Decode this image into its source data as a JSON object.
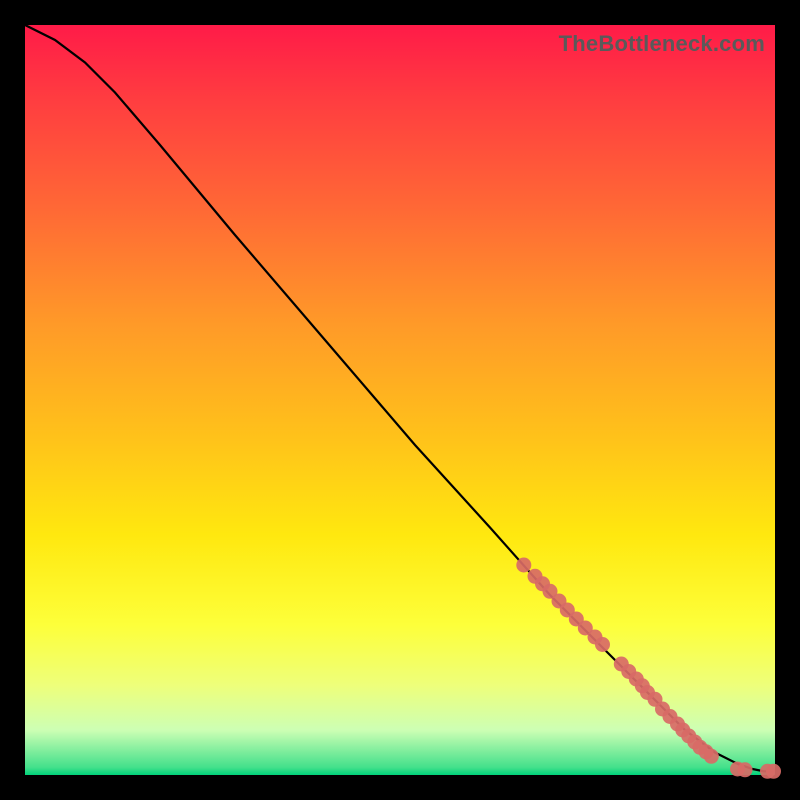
{
  "watermark": "TheBottleneck.com",
  "chart_data": {
    "type": "line",
    "title": "",
    "xlabel": "",
    "ylabel": "",
    "xlim": [
      0,
      100
    ],
    "ylim": [
      0,
      100
    ],
    "curve": {
      "x": [
        0,
        4,
        8,
        12,
        18,
        28,
        40,
        52,
        62,
        70,
        78,
        84,
        88,
        92,
        95,
        97,
        98.5,
        100
      ],
      "y": [
        100,
        98,
        95,
        91,
        84,
        72,
        58,
        44,
        33,
        24,
        16,
        10,
        6,
        3,
        1.5,
        0.8,
        0.5,
        0.5
      ]
    },
    "series": [
      {
        "name": "points",
        "color": "#d86a66",
        "points": [
          {
            "x": 66.5,
            "y": 28.0
          },
          {
            "x": 68.0,
            "y": 26.5
          },
          {
            "x": 69.0,
            "y": 25.5
          },
          {
            "x": 70.0,
            "y": 24.5
          },
          {
            "x": 71.2,
            "y": 23.2
          },
          {
            "x": 72.3,
            "y": 22.0
          },
          {
            "x": 73.5,
            "y": 20.8
          },
          {
            "x": 74.7,
            "y": 19.6
          },
          {
            "x": 76.0,
            "y": 18.4
          },
          {
            "x": 77.0,
            "y": 17.4
          },
          {
            "x": 79.5,
            "y": 14.8
          },
          {
            "x": 80.5,
            "y": 13.8
          },
          {
            "x": 81.5,
            "y": 12.8
          },
          {
            "x": 82.3,
            "y": 11.9
          },
          {
            "x": 83.0,
            "y": 11.0
          },
          {
            "x": 84.0,
            "y": 10.1
          },
          {
            "x": 85.0,
            "y": 8.8
          },
          {
            "x": 86.0,
            "y": 7.8
          },
          {
            "x": 87.0,
            "y": 6.8
          },
          {
            "x": 87.7,
            "y": 6.0
          },
          {
            "x": 88.5,
            "y": 5.2
          },
          {
            "x": 89.3,
            "y": 4.4
          },
          {
            "x": 90.0,
            "y": 3.7
          },
          {
            "x": 90.8,
            "y": 3.1
          },
          {
            "x": 91.5,
            "y": 2.5
          },
          {
            "x": 95.0,
            "y": 0.8
          },
          {
            "x": 96.0,
            "y": 0.7
          },
          {
            "x": 99.0,
            "y": 0.5
          },
          {
            "x": 99.8,
            "y": 0.5
          }
        ]
      }
    ]
  }
}
